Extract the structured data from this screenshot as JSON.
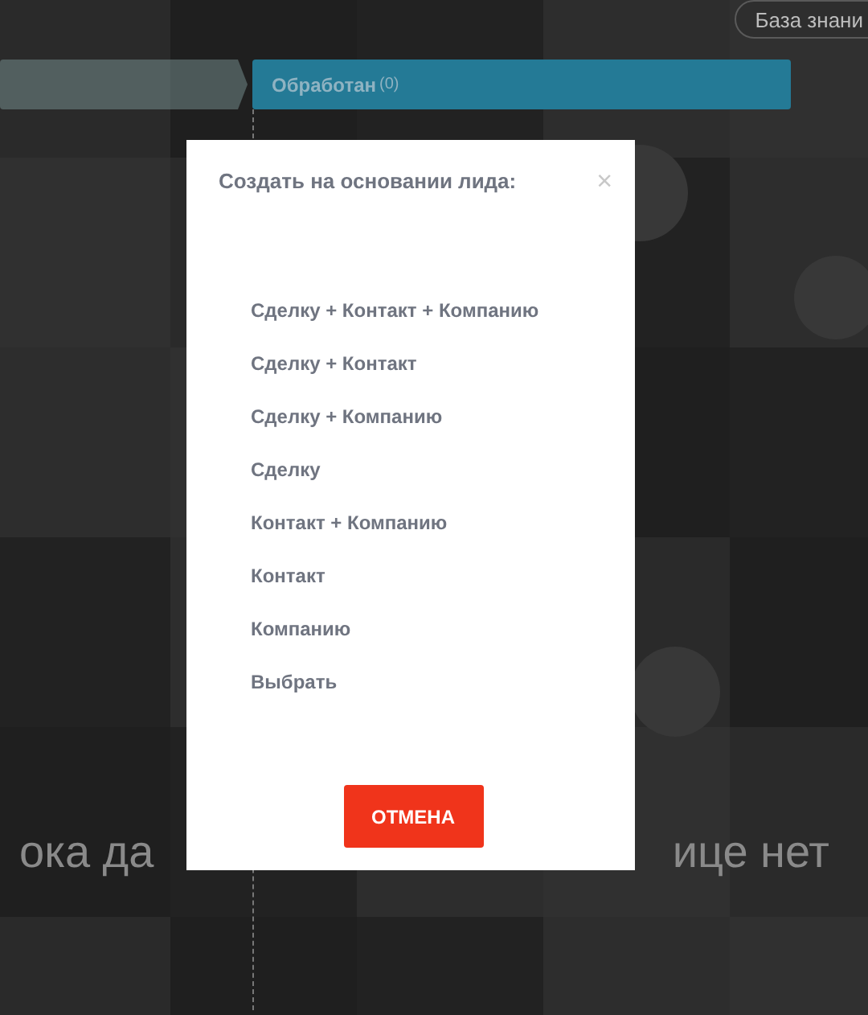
{
  "header": {
    "help_button": "База знани"
  },
  "pipeline": {
    "stages": [
      {
        "selected": false
      },
      {
        "label": "Обработан",
        "count": "(0)",
        "selected": true
      }
    ]
  },
  "empty_message": {
    "left_part": "ока да",
    "right_part": "ице нет"
  },
  "dialog": {
    "title": "Создать на основании лида:",
    "close": "×",
    "options": [
      {
        "label": "Сделку + Контакт + Компанию"
      },
      {
        "label": "Сделку + Контакт"
      },
      {
        "label": "Сделку + Компанию"
      },
      {
        "label": "Сделку"
      },
      {
        "label": "Контакт + Компанию"
      },
      {
        "label": "Контакт"
      },
      {
        "label": "Компанию"
      },
      {
        "label": "Выбрать"
      }
    ],
    "cancel_button": "ОТМЕНА"
  }
}
